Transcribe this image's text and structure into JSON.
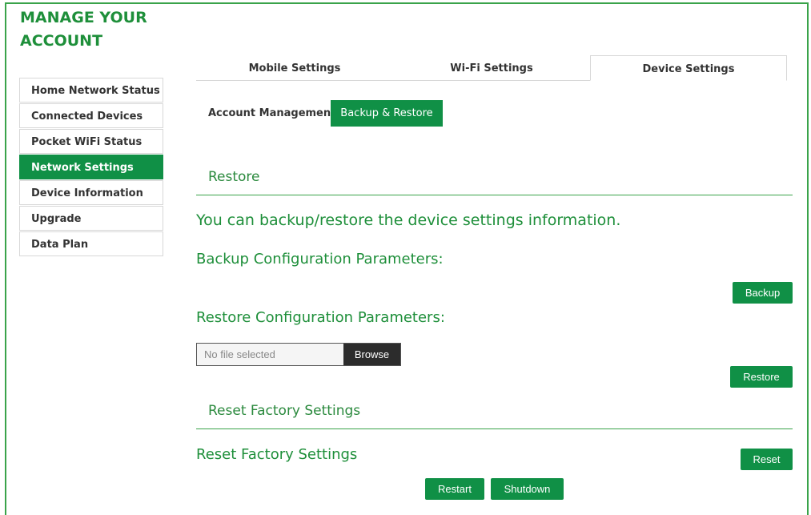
{
  "header": {
    "title_line1": "MANAGE YOUR",
    "title_line2": "ACCOUNT"
  },
  "sidebar": {
    "items": [
      {
        "label": "Home Network Status"
      },
      {
        "label": "Connected Devices"
      },
      {
        "label": "Pocket WiFi Status"
      },
      {
        "label": "Network Settings",
        "active": true
      },
      {
        "label": "Device Information"
      },
      {
        "label": "Upgrade"
      },
      {
        "label": "Data Plan"
      }
    ]
  },
  "tabs": [
    {
      "label": "Mobile Settings"
    },
    {
      "label": "Wi-Fi Settings"
    },
    {
      "label": "Device Settings",
      "active": true
    }
  ],
  "subtabs": [
    {
      "label": "Account Management"
    },
    {
      "label": "Backup & Restore",
      "active": true
    }
  ],
  "restore": {
    "heading": "Restore",
    "intro": "You can backup/restore the device settings information.",
    "backup_label": "Backup Configuration Parameters:",
    "backup_button": "Backup",
    "restore_label": "Restore Configuration Parameters:",
    "file_placeholder": "No file selected",
    "browse_button": "Browse",
    "restore_button": "Restore"
  },
  "reset": {
    "heading": "Reset Factory Settings",
    "label": "Reset Factory Settings",
    "reset_button": "Reset",
    "restart_button": "Restart",
    "shutdown_button": "Shutdown"
  },
  "colors": {
    "accent": "#109046",
    "text_green": "#1e8f3a",
    "border": "#d8d8d8"
  }
}
